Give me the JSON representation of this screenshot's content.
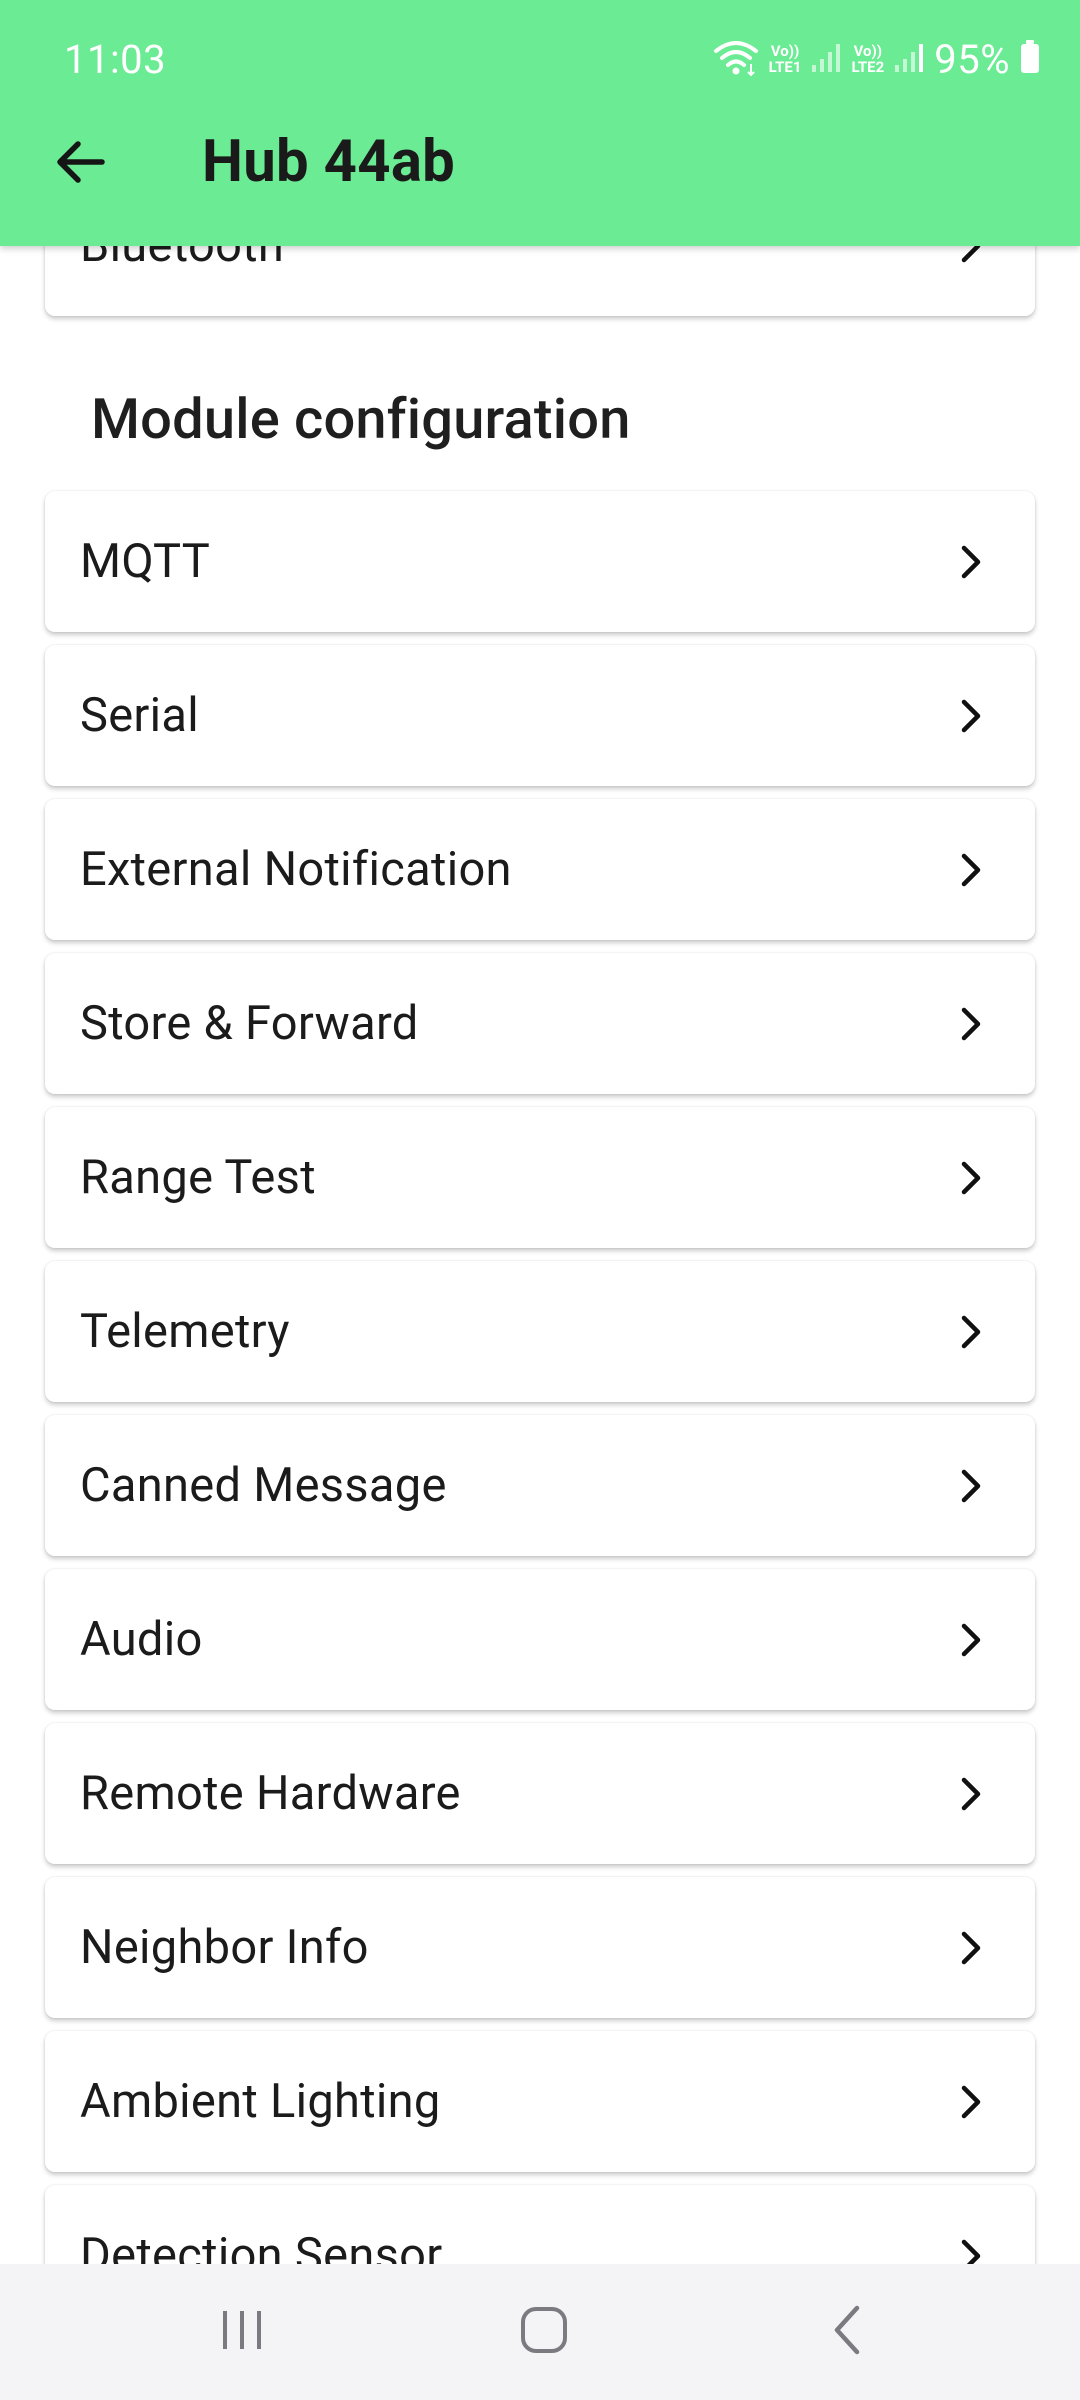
{
  "status_bar": {
    "time": "11:03",
    "battery": "95%",
    "sim1": "LTE1",
    "sim2": "LTE2",
    "volte": "Vo))"
  },
  "header": {
    "title": "Hub 44ab",
    "back_icon": "arrow-back-icon",
    "color": "#6beb94"
  },
  "partial_top_item": "Bluetooth",
  "section": {
    "title": "Module configuration"
  },
  "items": [
    {
      "label": "MQTT"
    },
    {
      "label": "Serial"
    },
    {
      "label": "External Notification"
    },
    {
      "label": "Store & Forward"
    },
    {
      "label": "Range Test"
    },
    {
      "label": "Telemetry"
    },
    {
      "label": "Canned Message"
    },
    {
      "label": "Audio"
    },
    {
      "label": "Remote Hardware"
    },
    {
      "label": "Neighbor Info"
    },
    {
      "label": "Ambient Lighting"
    },
    {
      "label": "Detection Sensor"
    }
  ],
  "nav": {
    "recents_icon": "recents-icon",
    "home_icon": "home-icon",
    "back_icon": "nav-back-icon"
  }
}
